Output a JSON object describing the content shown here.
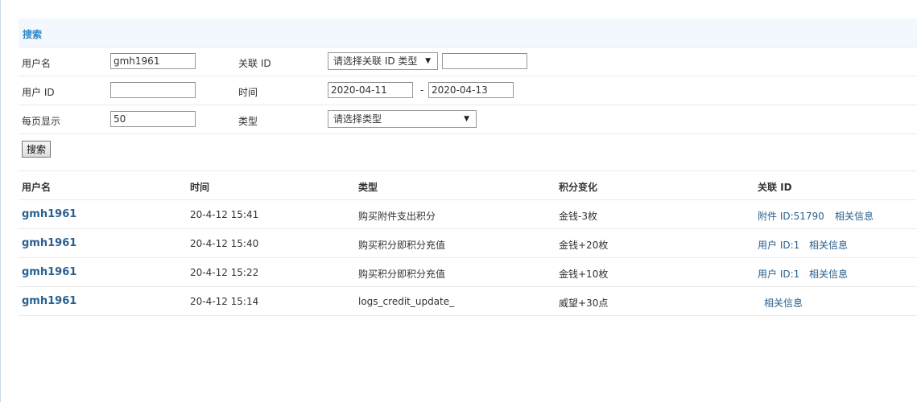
{
  "search": {
    "title": "搜索",
    "fields": {
      "username_label": "用户名",
      "username_value": "gmh1961",
      "related_id_label": "关联 ID",
      "related_type_selected": "请选择关联 ID 类型",
      "related_id_value": "",
      "user_id_label": "用户 ID",
      "user_id_value": "",
      "time_label": "时间",
      "time_from": "2020-04-11",
      "time_separator": "-",
      "time_to": "2020-04-13",
      "per_page_label": "每页显示",
      "per_page_value": "50",
      "type_label": "类型",
      "type_selected": "请选择类型"
    },
    "submit_label": "搜索"
  },
  "table": {
    "headers": [
      "用户名",
      "时间",
      "类型",
      "积分变化",
      "关联 ID"
    ],
    "rows": [
      {
        "user": "gmh1961",
        "time": "20-4-12 15:41",
        "type": "购买附件支出积分",
        "change": "金钱-3枚",
        "related_prefix": "附件 ID:51790",
        "related_link": "相关信息"
      },
      {
        "user": "gmh1961",
        "time": "20-4-12 15:40",
        "type": "购买积分即积分充值",
        "change": "金钱+20枚",
        "related_prefix": "用户 ID:1",
        "related_link": "相关信息"
      },
      {
        "user": "gmh1961",
        "time": "20-4-12 15:22",
        "type": "购买积分即积分充值",
        "change": "金钱+10枚",
        "related_prefix": "用户 ID:1",
        "related_link": "相关信息"
      },
      {
        "user": "gmh1961",
        "time": "20-4-12 15:14",
        "type": "logs_credit_update_",
        "change": "威望+30点",
        "related_prefix": "",
        "related_link": "相关信息"
      }
    ]
  }
}
